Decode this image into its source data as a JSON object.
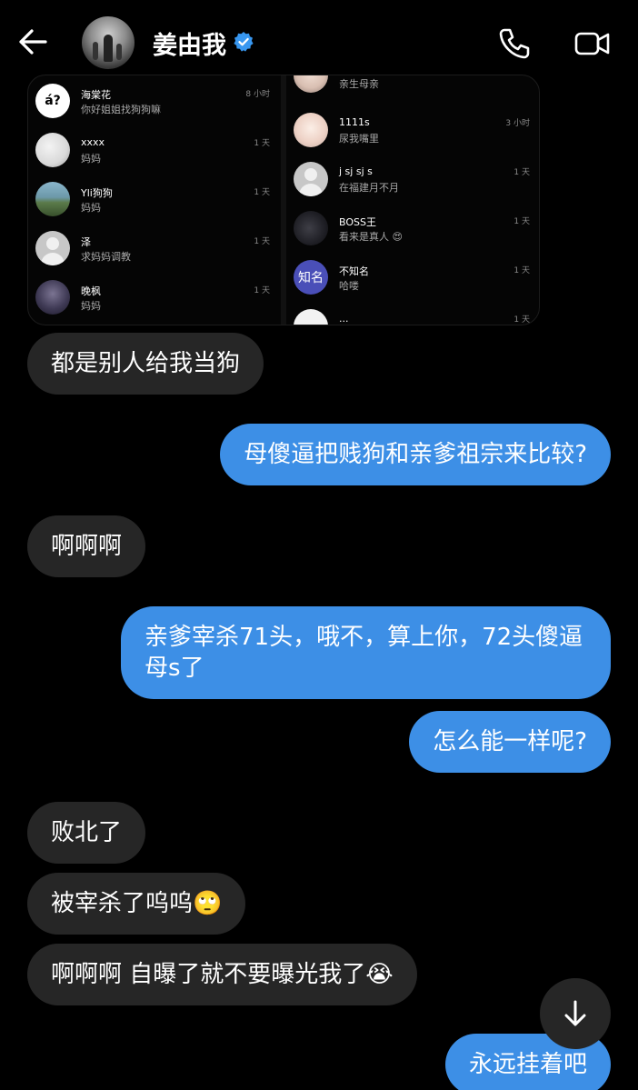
{
  "header": {
    "contact_name": "姜由我",
    "icons": [
      "back-arrow-icon",
      "verified-badge-icon",
      "phone-icon",
      "video-camera-icon"
    ]
  },
  "shared_screenshot": {
    "left_column": [
      {
        "avatar_text": "á?",
        "name": "海棠花",
        "preview": "你好姐姐找狗狗嘛",
        "time": "8 小时"
      },
      {
        "avatar_text": "",
        "name": "xxxx",
        "preview": "妈妈",
        "time": "1 天"
      },
      {
        "avatar_text": "",
        "name": "Yli狗狗",
        "preview": "妈妈",
        "time": "1 天"
      },
      {
        "avatar_text": "",
        "name": "泽",
        "preview": "求妈妈调教",
        "time": "1 天"
      },
      {
        "avatar_text": "",
        "name": "晚枫",
        "preview": "妈妈",
        "time": "1 天"
      }
    ],
    "right_column": [
      {
        "avatar_text": "",
        "name": "",
        "preview": "亲生母亲",
        "time": ""
      },
      {
        "avatar_text": "",
        "name": "1111s",
        "preview": "尿我嘴里",
        "time": "3 小时"
      },
      {
        "avatar_text": "",
        "name": "j sj sj s",
        "preview": "在福建月不月",
        "time": "1 天"
      },
      {
        "avatar_text": "",
        "name": "BOSS王",
        "preview": "看来是真人 😍",
        "time": "1 天"
      },
      {
        "avatar_text": "知名",
        "name": "不知名",
        "preview": "哈喽",
        "time": "1 天"
      },
      {
        "avatar_text": "",
        "name": "...",
        "preview": "",
        "time": "1 天"
      }
    ]
  },
  "messages": [
    {
      "side": "in",
      "text": "都是别人给我当狗"
    },
    {
      "side": "out",
      "text": "母傻逼把贱狗和亲爹祖宗来比较?"
    },
    {
      "side": "in",
      "text": "啊啊啊"
    },
    {
      "side": "out",
      "text": "亲爹宰杀71头，哦不，算上你，72头傻逼母s了"
    },
    {
      "side": "out",
      "text": "怎么能一样呢?"
    },
    {
      "side": "in",
      "text": "败北了"
    },
    {
      "side": "in",
      "text": "被宰杀了呜呜🙄"
    },
    {
      "side": "in",
      "text": "啊啊啊 自曝了就不要曝光我了😭"
    },
    {
      "side": "out",
      "text": "永远挂着吧"
    }
  ],
  "colors": {
    "background": "#000000",
    "incoming_bubble": "#262626",
    "outgoing_bubble": "#3d8fe6",
    "verified": "#3897f0"
  }
}
